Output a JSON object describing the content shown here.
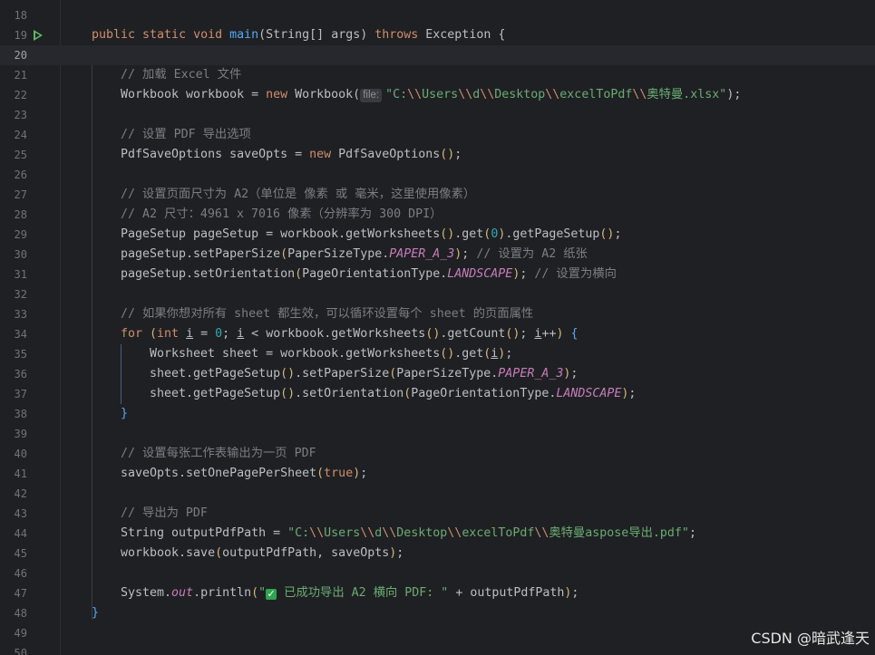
{
  "lines": [
    {
      "n": "18",
      "text": ""
    },
    {
      "n": "19",
      "text": "public static void main(String[] args) throws Exception {"
    },
    {
      "n": "20",
      "text": ""
    },
    {
      "n": "21",
      "text": "// 加载 Excel 文件"
    },
    {
      "n": "22",
      "text": "Workbook workbook = new Workbook(file: \"C:\\\\Users\\\\d\\\\Desktop\\\\excelToPdf\\\\奥特曼.xlsx\");"
    },
    {
      "n": "23",
      "text": ""
    },
    {
      "n": "24",
      "text": "// 设置 PDF 导出选项"
    },
    {
      "n": "25",
      "text": "PdfSaveOptions saveOpts = new PdfSaveOptions();"
    },
    {
      "n": "26",
      "text": ""
    },
    {
      "n": "27",
      "text": "// 设置页面尺寸为 A2（单位是 像素 或 毫米，这里使用像素）"
    },
    {
      "n": "28",
      "text": "// A2 尺寸：4961 x 7016 像素（分辨率为 300 DPI）"
    },
    {
      "n": "29",
      "text": "PageSetup pageSetup = workbook.getWorksheets().get(0).getPageSetup();"
    },
    {
      "n": "30",
      "text": "pageSetup.setPaperSize(PaperSizeType.PAPER_A_3); // 设置为 A2 纸张"
    },
    {
      "n": "31",
      "text": "pageSetup.setOrientation(PageOrientationType.LANDSCAPE); // 设置为横向"
    },
    {
      "n": "32",
      "text": ""
    },
    {
      "n": "33",
      "text": "// 如果你想对所有 sheet 都生效，可以循环设置每个 sheet 的页面属性"
    },
    {
      "n": "34",
      "text": "for (int i = 0; i < workbook.getWorksheets().getCount(); i++) {"
    },
    {
      "n": "35",
      "text": "Worksheet sheet = workbook.getWorksheets().get(i);"
    },
    {
      "n": "36",
      "text": "sheet.getPageSetup().setPaperSize(PaperSizeType.PAPER_A_3);"
    },
    {
      "n": "37",
      "text": "sheet.getPageSetup().setOrientation(PageOrientationType.LANDSCAPE);"
    },
    {
      "n": "38",
      "text": "}"
    },
    {
      "n": "39",
      "text": ""
    },
    {
      "n": "40",
      "text": "// 设置每张工作表输出为一页 PDF"
    },
    {
      "n": "41",
      "text": "saveOpts.setOnePagePerSheet(true);"
    },
    {
      "n": "42",
      "text": ""
    },
    {
      "n": "43",
      "text": "// 导出为 PDF"
    },
    {
      "n": "44",
      "text": "String outputPdfPath = \"C:\\\\Users\\\\d\\\\Desktop\\\\excelToPdf\\\\奥特曼aspose导出.pdf\";"
    },
    {
      "n": "45",
      "text": "workbook.save(outputPdfPath, saveOpts);"
    },
    {
      "n": "46",
      "text": ""
    },
    {
      "n": "47",
      "text": "System.out.println(\"✓ 已成功导出 A2 横向 PDF: \" + outputPdfPath);"
    },
    {
      "n": "48",
      "text": "}"
    },
    {
      "n": "49",
      "text": ""
    },
    {
      "n": "50",
      "text": ""
    }
  ],
  "current_line": "20",
  "watermark": "CSDN @暗武逢天",
  "icons": {
    "run": "run-gutter-icon",
    "check": "check-mark-emoji"
  },
  "colors": {
    "background": "#1f2023",
    "keyword": "#cf8e6d",
    "method": "#56a8f5",
    "string": "#6aab73",
    "comment": "#7a7e85",
    "constant": "#c77dbb",
    "number": "#2aacb8",
    "text": "#bcbec4"
  }
}
